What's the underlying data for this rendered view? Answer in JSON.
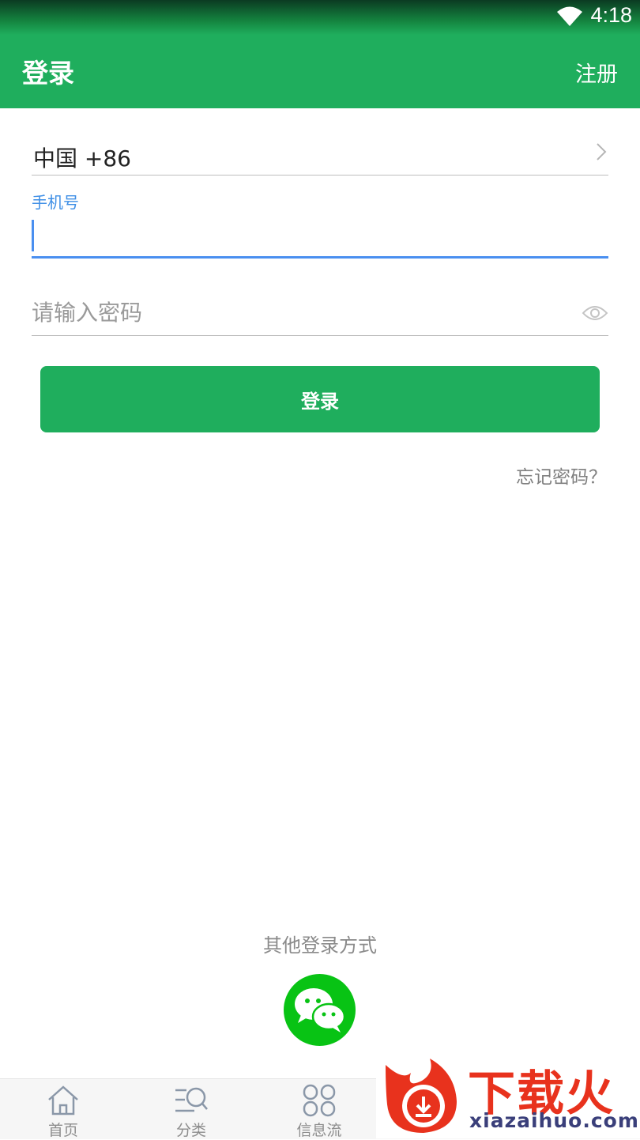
{
  "status_bar": {
    "time": "4:18"
  },
  "header": {
    "title": "登录",
    "register_label": "注册"
  },
  "form": {
    "country_code": "中国 +86",
    "phone_label": "手机号",
    "phone_value": "",
    "password_placeholder": "请输入密码",
    "login_button": "登录",
    "forgot_password": "忘记密码？"
  },
  "other_login": {
    "label": "其他登录方式"
  },
  "tabbar": {
    "items": [
      {
        "label": "首页",
        "icon": "home-icon"
      },
      {
        "label": "分类",
        "icon": "category-search-icon"
      },
      {
        "label": "信息流",
        "icon": "grid-icon"
      }
    ]
  },
  "watermark": {
    "brand": "下载火",
    "url": "xiazaihuo.com"
  },
  "colors": {
    "primary": "#1fae5d",
    "focus": "#4a8ff0",
    "wechat": "#08c314",
    "watermark": "#e8321d"
  }
}
